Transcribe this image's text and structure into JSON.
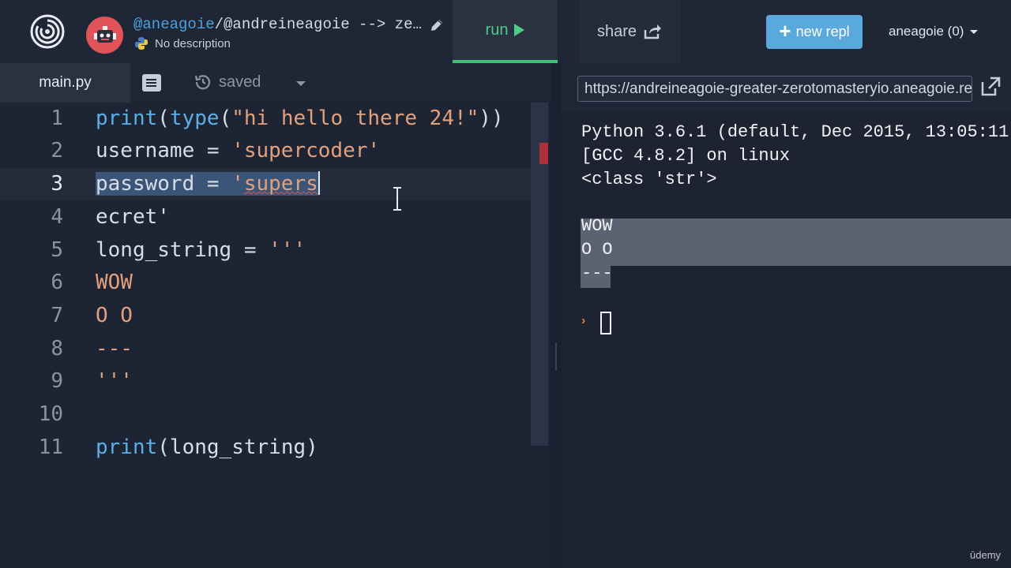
{
  "header": {
    "owner": "@aneagoie",
    "repl_path": "/@andreineagoie --> ze…",
    "description": "No description",
    "run_label": "run",
    "share_label": "share",
    "new_repl_label": "new repl",
    "user_label": "aneagoie (0)"
  },
  "editor": {
    "file_tab": "main.py",
    "status": "saved",
    "lines": [
      {
        "num": "1"
      },
      {
        "num": "2"
      },
      {
        "num": "3"
      },
      {
        "num": "4"
      },
      {
        "num": "5"
      },
      {
        "num": "6"
      },
      {
        "num": "7"
      },
      {
        "num": "8"
      },
      {
        "num": "9"
      },
      {
        "num": "10"
      },
      {
        "num": "11"
      }
    ],
    "code": {
      "l1_print": "print",
      "l1_paren": "(",
      "l1_type": "type",
      "l1_paren2": "(",
      "l1_str": "\"hi hello there 24!\"",
      "l1_close": "))",
      "l2_var": "username = ",
      "l2_str": "'supercoder'",
      "l3_var": "password = ",
      "l3_str_a": "'",
      "l3_str_b": "supers",
      "l4_text": "ecret'",
      "l5_var": "long_string = ",
      "l5_str": "'''",
      "l6_str": "WOW",
      "l7_str": "O O",
      "l8_str": "---",
      "l9_str": "'''",
      "l11_print": "print",
      "l11_args": "(long_string)"
    }
  },
  "console": {
    "url": "https://andreineagoie-greater-zerotomasteryio.aneagoie.repl.run",
    "lines": [
      "Python 3.6.1 (default, Dec 2015, 13:05:11)",
      "[GCC 4.8.2] on linux",
      "<class 'str'>",
      "",
      "WOW",
      "O O",
      "---"
    ],
    "prompt": "›"
  },
  "watermark": "ūdemy",
  "colors": {
    "accent_run": "#4ccd88",
    "new_repl_bg": "#5aa9dd",
    "keyword_fn": "#5ab0e8",
    "string": "#e2a17c",
    "selection": "#3b5578"
  }
}
